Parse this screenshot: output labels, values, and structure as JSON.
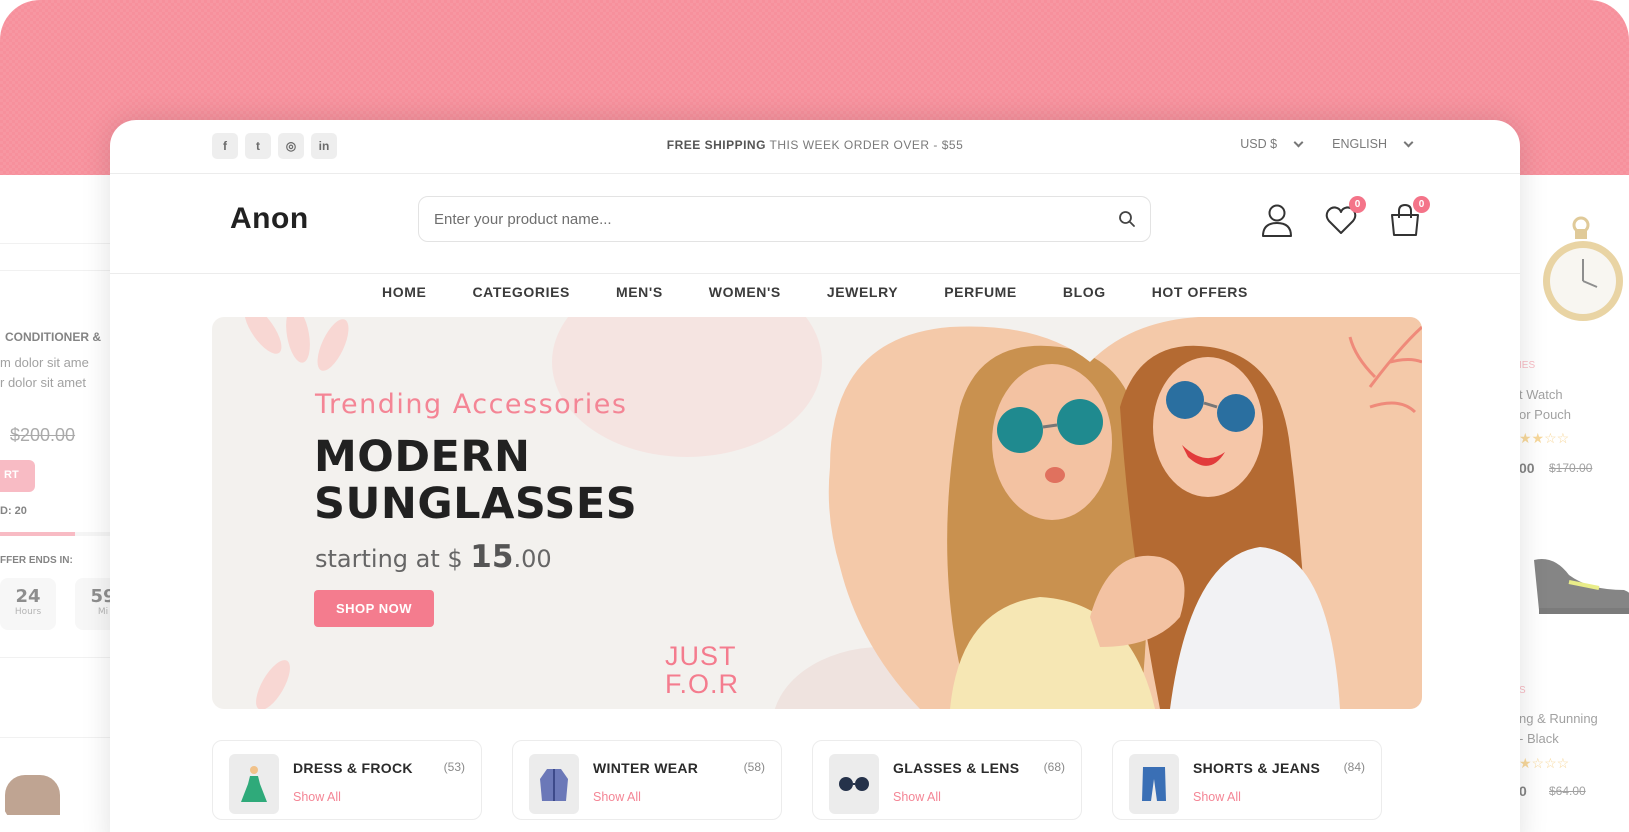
{
  "topbar": {
    "socials": [
      {
        "icon": "facebook-icon",
        "glyph": "f"
      },
      {
        "icon": "twitter-icon",
        "glyph": "t"
      },
      {
        "icon": "instagram-icon",
        "glyph": "◎"
      },
      {
        "icon": "linkedin-icon",
        "glyph": "in"
      }
    ],
    "promo_prefix": "FREE SHIPPING",
    "promo_rest": " THIS WEEK ORDER OVER - $55",
    "currency": "USD $",
    "language": "ENGLISH"
  },
  "header": {
    "logo": "Anon",
    "search_placeholder": "Enter your product name...",
    "wishlist_count": "0",
    "cart_count": "0"
  },
  "nav": [
    "HOME",
    "CATEGORIES",
    "MEN'S",
    "WOMEN'S",
    "JEWELRY",
    "PERFUME",
    "BLOG",
    "HOT OFFERS"
  ],
  "banner": {
    "subtitle": "Trending Accessories",
    "title": "Modern Sunglasses",
    "price_prefix": "starting at $ ",
    "price_whole": "15",
    "price_cents": ".00",
    "button": "SHOP NOW",
    "decor_text_line1": "JUST",
    "decor_text_line2": "F.O.R"
  },
  "categories": [
    {
      "name": "DRESS & FROCK",
      "count": "(53)",
      "link": "Show All",
      "icon": "dress-icon"
    },
    {
      "name": "WINTER WEAR",
      "count": "(58)",
      "link": "Show All",
      "icon": "coat-icon"
    },
    {
      "name": "GLASSES & LENS",
      "count": "(68)",
      "link": "Show All",
      "icon": "glasses-icon"
    },
    {
      "name": "SHORTS & JEANS",
      "count": "(84)",
      "link": "Show All",
      "icon": "jeans-icon"
    }
  ],
  "left_preview": {
    "title": "CONDITIONER &",
    "desc1": "m dolor sit ame",
    "desc2": "r dolor sit amet",
    "old_price": "$200.00",
    "cart_label": "RT",
    "sold": "D: 20",
    "offer": "FFER ENDS IN:",
    "hours": "24",
    "hours_label": "Hours",
    "min": "59",
    "min_label": "Mi"
  },
  "right_preview": {
    "cat1": "IES",
    "name1a": "t Watch",
    "name1b": "or Pouch",
    "price1": "00",
    "old1": "$170.00",
    "cat2": "S",
    "name2a": "ng & Running",
    "name2b": "- Black",
    "price2": "0",
    "old2": "$64.00"
  },
  "colors": {
    "accent": "#f47c8e",
    "pink_background": "#f7909c",
    "text_dark": "#212121"
  }
}
